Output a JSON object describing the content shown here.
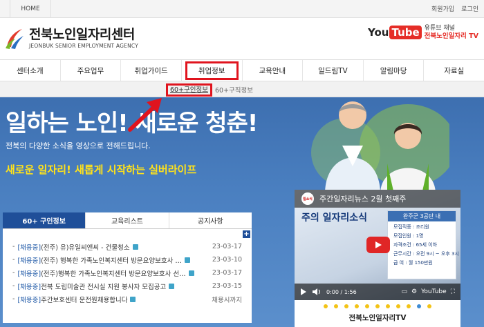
{
  "topbar": {
    "home": "HOME",
    "util": [
      "회원가입",
      "로그인"
    ]
  },
  "header": {
    "title": "전북노인일자리센터",
    "subtitle": "JEONBUK SENIOR EMPLOYMENT AGENCY",
    "yt_logo_a": "You",
    "yt_logo_b": "Tube",
    "yt_label": "유튜브 채널",
    "yt_channel": "전북노인일자리 TV"
  },
  "nav": [
    "센터소개",
    "주요업무",
    "취업가이드",
    "취업정보",
    "교육안내",
    "일드림TV",
    "알림마당",
    "자료실"
  ],
  "subnav": [
    "60+구인정보",
    "60+구직정보"
  ],
  "hero": {
    "title": "일하는 노인! 새로운 청춘!",
    "desc": "전북의 다양한 소식을 영상으로 전해드립니다.",
    "slogan": "새로운 일자리! 새롭게 시작하는 실버라이프"
  },
  "panel": {
    "tabs": [
      "60+ 구인정보",
      "교육리스트",
      "공지사항"
    ],
    "rows": [
      {
        "status": "[채용중]",
        "title": "(전주) 유)유일씨앤씨 - 건물청소",
        "date": "23-03-17"
      },
      {
        "status": "[채용중]",
        "title": "(전주) 행복한 가족노인복지센터 방문요양보호사 …",
        "date": "23-03-10"
      },
      {
        "status": "[채용중]",
        "title": "(전주)행복한 가족노인복지센터 방문요양보호사 선…",
        "date": "23-03-17"
      },
      {
        "status": "[채용중]",
        "title": "전북 도립미술관 전시실 지원 봉사자 모집공고",
        "date": "23-03-15"
      },
      {
        "status": "[채용중]",
        "title": "주간보호센터 운전원채용합니다",
        "date": "채용시까지"
      }
    ]
  },
  "video": {
    "badge": "일소식",
    "title": "주간일자리뉴스 2월 첫째주",
    "headline": "주의 일자리소식",
    "card_head": "완주군 3공단 내",
    "card_lines": [
      "모집직종 : 조리원",
      "모집인원 : 1명",
      "자격조건 : 65세 이하",
      "근무시간 : 오전 9시 ~ 오후 3시",
      "급    여 : 월 150만원"
    ],
    "time": "0:00 / 1:56",
    "brand": "YouTube",
    "caption": "전북노인일자리TV"
  }
}
